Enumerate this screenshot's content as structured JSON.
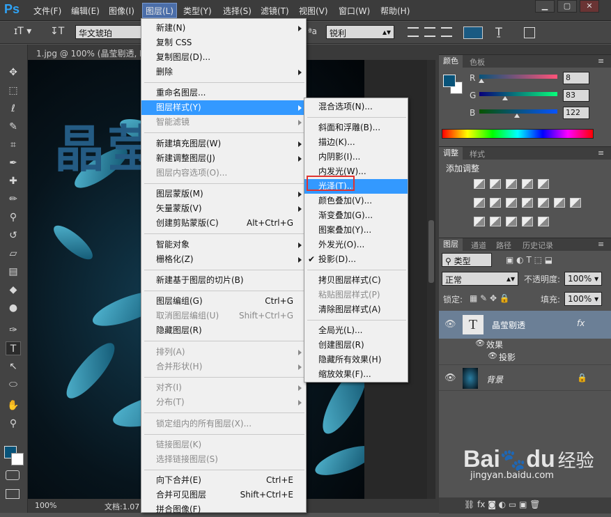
{
  "app": {
    "logo": "Ps"
  },
  "menubar": [
    "文件(F)",
    "编辑(E)",
    "图像(I)",
    "图层(L)",
    "类型(Y)",
    "选择(S)",
    "滤镜(T)",
    "视图(V)",
    "窗口(W)",
    "帮助(H)"
  ],
  "window_controls": [
    "▁",
    "▢",
    "✕"
  ],
  "options": {
    "font": "华文琥珀",
    "aa_icon": "ªa",
    "aa": "锐利"
  },
  "colors": {
    "accent": "#3399ff",
    "fg_swatch": "#085379",
    "text_color": "#1a5a82"
  },
  "doc": {
    "tab": "1.jpg @ 100% (晶莹剔透, RG",
    "canvas_text": "晶莹",
    "zoom": "100%",
    "status": "文档:1.07"
  },
  "layer_menu": [
    {
      "label": "新建(N)",
      "shortcut": "",
      "arrow": true,
      "disabled": false
    },
    {
      "label": "复制 CSS",
      "shortcut": "",
      "arrow": false,
      "disabled": false
    },
    {
      "label": "复制图层(D)...",
      "shortcut": "",
      "arrow": false,
      "disabled": false
    },
    {
      "label": "删除",
      "shortcut": "",
      "arrow": true,
      "disabled": false
    },
    {
      "sep": true
    },
    {
      "label": "重命名图层...",
      "shortcut": "",
      "arrow": false,
      "disabled": false
    },
    {
      "label": "图层样式(Y)",
      "shortcut": "",
      "arrow": true,
      "disabled": false,
      "highlight": true
    },
    {
      "label": "智能滤镜",
      "shortcut": "",
      "arrow": true,
      "disabled": true
    },
    {
      "sep": true
    },
    {
      "label": "新建填充图层(W)",
      "shortcut": "",
      "arrow": true,
      "disabled": false
    },
    {
      "label": "新建调整图层(J)",
      "shortcut": "",
      "arrow": true,
      "disabled": false
    },
    {
      "label": "图层内容选项(O)...",
      "shortcut": "",
      "arrow": false,
      "disabled": true
    },
    {
      "sep": true
    },
    {
      "label": "图层蒙版(M)",
      "shortcut": "",
      "arrow": true,
      "disabled": false
    },
    {
      "label": "矢量蒙版(V)",
      "shortcut": "",
      "arrow": true,
      "disabled": false
    },
    {
      "label": "创建剪贴蒙版(C)",
      "shortcut": "Alt+Ctrl+G",
      "arrow": false,
      "disabled": false
    },
    {
      "sep": true
    },
    {
      "label": "智能对象",
      "shortcut": "",
      "arrow": true,
      "disabled": false
    },
    {
      "label": "栅格化(Z)",
      "shortcut": "",
      "arrow": true,
      "disabled": false
    },
    {
      "sep": true
    },
    {
      "label": "新建基于图层的切片(B)",
      "shortcut": "",
      "arrow": false,
      "disabled": false
    },
    {
      "sep": true
    },
    {
      "label": "图层编组(G)",
      "shortcut": "Ctrl+G",
      "arrow": false,
      "disabled": false
    },
    {
      "label": "取消图层编组(U)",
      "shortcut": "Shift+Ctrl+G",
      "arrow": false,
      "disabled": true
    },
    {
      "label": "隐藏图层(R)",
      "shortcut": "",
      "arrow": false,
      "disabled": false
    },
    {
      "sep": true
    },
    {
      "label": "排列(A)",
      "shortcut": "",
      "arrow": true,
      "disabled": true
    },
    {
      "label": "合并形状(H)",
      "shortcut": "",
      "arrow": true,
      "disabled": true
    },
    {
      "sep": true
    },
    {
      "label": "对齐(I)",
      "shortcut": "",
      "arrow": true,
      "disabled": true
    },
    {
      "label": "分布(T)",
      "shortcut": "",
      "arrow": true,
      "disabled": true
    },
    {
      "sep": true
    },
    {
      "label": "锁定组内的所有图层(X)...",
      "shortcut": "",
      "arrow": false,
      "disabled": true
    },
    {
      "sep": true
    },
    {
      "label": "链接图层(K)",
      "shortcut": "",
      "arrow": false,
      "disabled": true
    },
    {
      "label": "选择链接图层(S)",
      "shortcut": "",
      "arrow": false,
      "disabled": true
    },
    {
      "sep": true
    },
    {
      "label": "向下合并(E)",
      "shortcut": "Ctrl+E",
      "arrow": false,
      "disabled": false
    },
    {
      "label": "合并可见图层",
      "shortcut": "Shift+Ctrl+E",
      "arrow": false,
      "disabled": false
    },
    {
      "label": "拼合图像(F)",
      "shortcut": "",
      "arrow": false,
      "disabled": false
    }
  ],
  "style_submenu": [
    {
      "label": "混合选项(N)...",
      "check": false,
      "disabled": false
    },
    {
      "sep": true
    },
    {
      "label": "斜面和浮雕(B)...",
      "check": false,
      "disabled": false
    },
    {
      "label": "描边(K)...",
      "check": false,
      "disabled": false
    },
    {
      "label": "内阴影(I)...",
      "check": false,
      "disabled": false
    },
    {
      "label": "内发光(W)...",
      "check": false,
      "disabled": false
    },
    {
      "label": "光泽(T)...",
      "check": false,
      "disabled": false,
      "highlight": true
    },
    {
      "label": "颜色叠加(V)...",
      "check": false,
      "disabled": false
    },
    {
      "label": "渐变叠加(G)...",
      "check": false,
      "disabled": false
    },
    {
      "label": "图案叠加(Y)...",
      "check": false,
      "disabled": false
    },
    {
      "label": "外发光(O)...",
      "check": false,
      "disabled": false
    },
    {
      "label": "投影(D)...",
      "check": true,
      "disabled": false
    },
    {
      "sep": true
    },
    {
      "label": "拷贝图层样式(C)",
      "check": false,
      "disabled": false
    },
    {
      "label": "粘贴图层样式(P)",
      "check": false,
      "disabled": true
    },
    {
      "label": "清除图层样式(A)",
      "check": false,
      "disabled": false
    },
    {
      "sep": true
    },
    {
      "label": "全局光(L)...",
      "check": false,
      "disabled": false
    },
    {
      "label": "创建图层(R)",
      "check": false,
      "disabled": false
    },
    {
      "label": "隐藏所有效果(H)",
      "check": false,
      "disabled": false
    },
    {
      "label": "缩放效果(F)...",
      "check": false,
      "disabled": false
    }
  ],
  "color_panel": {
    "tabs": [
      "颜色",
      "色板"
    ],
    "channels": [
      {
        "name": "R",
        "value": "8",
        "level": 0.03
      },
      {
        "name": "G",
        "value": "83",
        "level": 0.33
      },
      {
        "name": "B",
        "value": "122",
        "level": 0.48
      }
    ]
  },
  "adjust_panel": {
    "tabs": [
      "调整",
      "样式"
    ],
    "title": "添加调整"
  },
  "layers_panel": {
    "tabs": [
      "图层",
      "通道",
      "路径",
      "历史记录"
    ],
    "filter": "类型",
    "blend": "正常",
    "opacity_label": "不透明度:",
    "opacity": "100%",
    "lock_label": "锁定:",
    "fill_label": "填充:",
    "fill": "100%",
    "layers": [
      {
        "name": "晶莹剔透",
        "fx": "fx",
        "effects_label": "效果",
        "effect": "投影"
      },
      {
        "name": "背景"
      }
    ]
  },
  "watermark": {
    "brand": "Bai",
    "brand2": "du",
    "sub": "经验",
    "url": "jingyan.baidu.com"
  }
}
